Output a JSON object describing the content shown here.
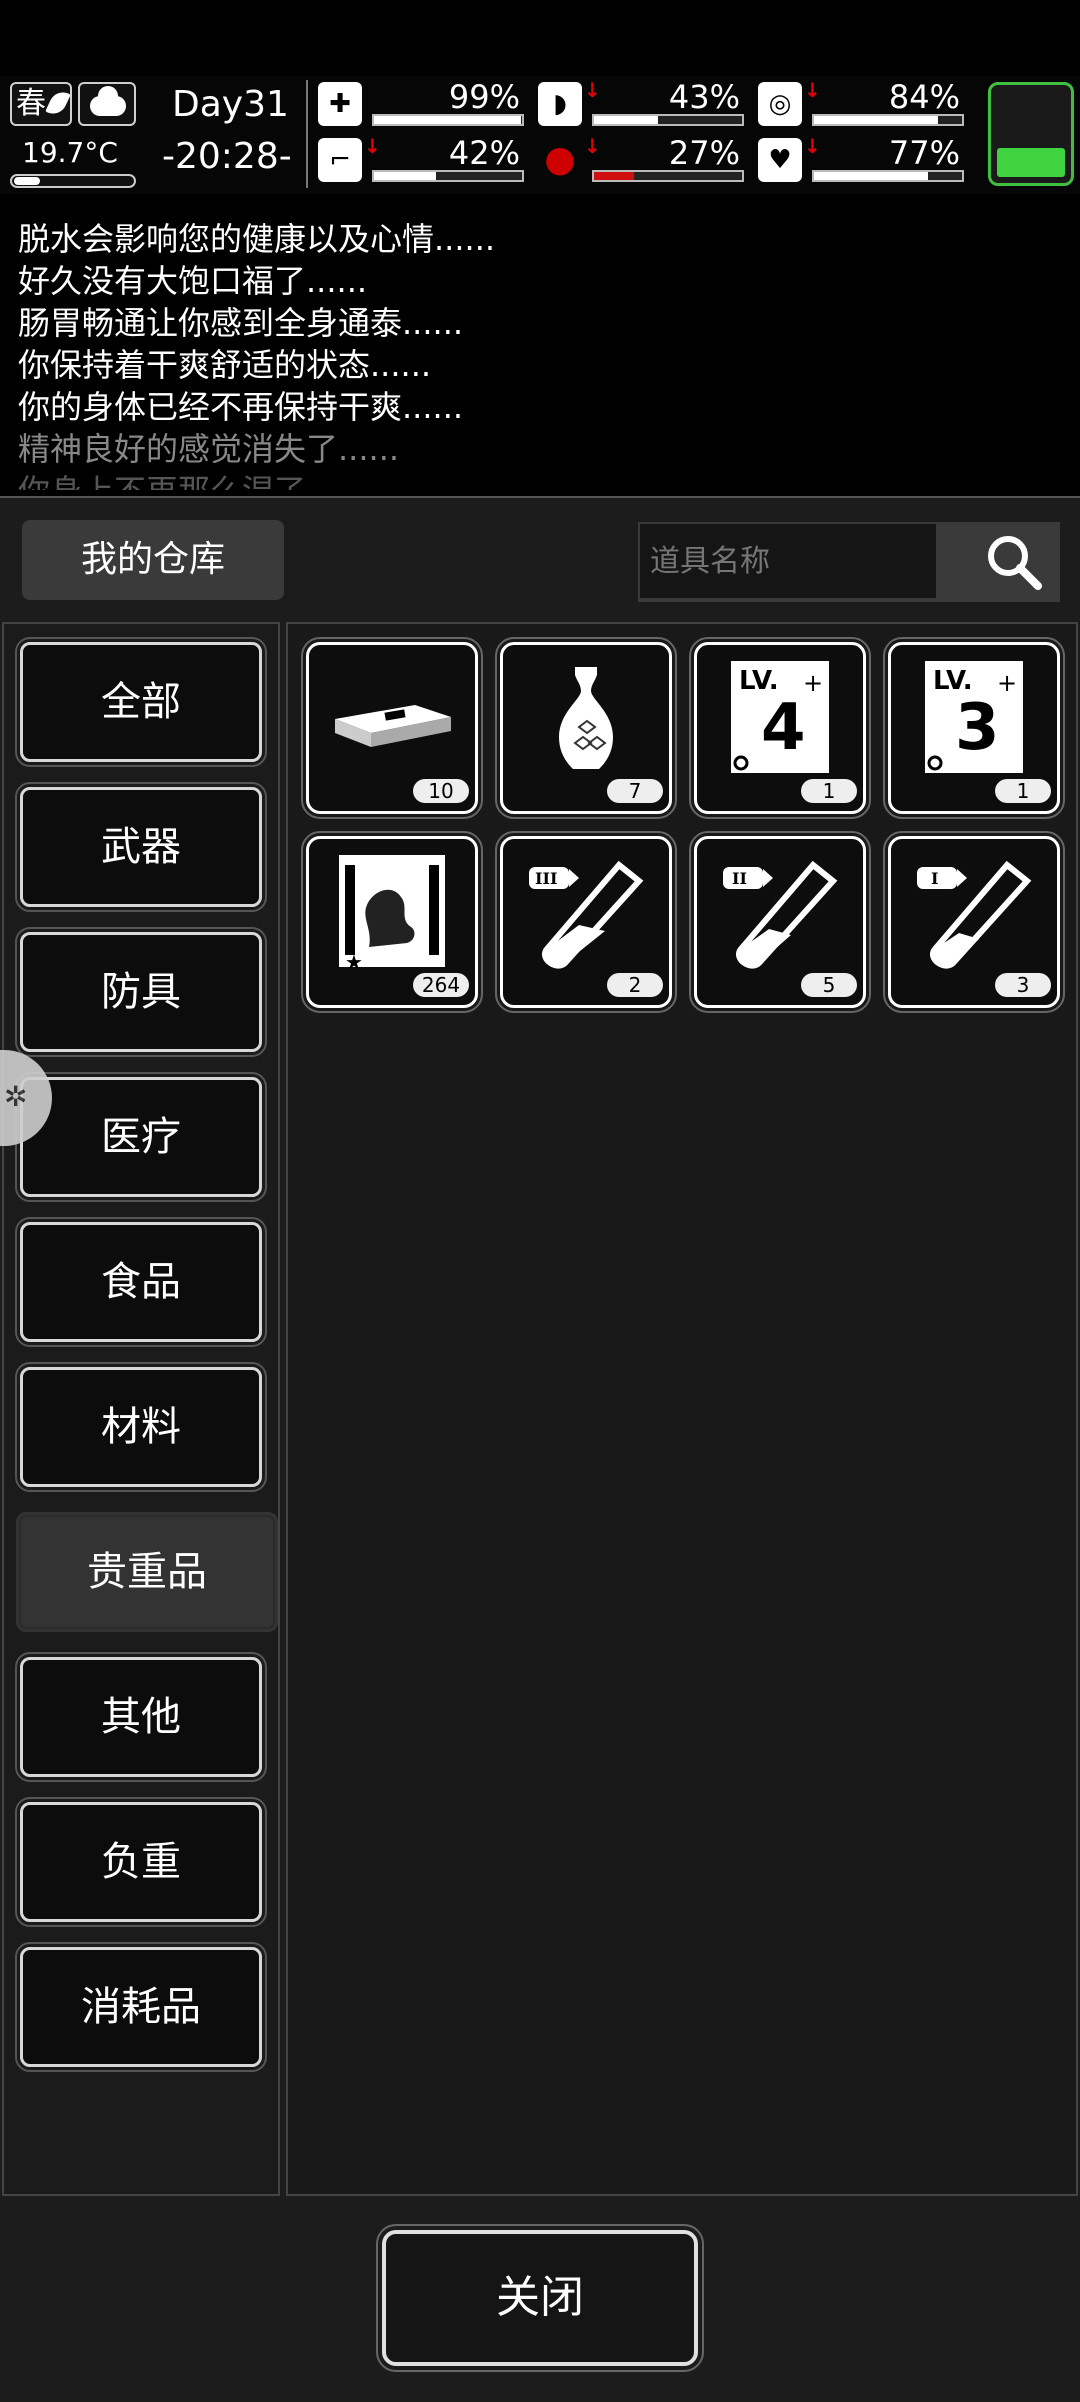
{
  "hud": {
    "season": "春",
    "temperature": "19.7°C",
    "day": "Day31",
    "time": "-20:28-",
    "stats": [
      {
        "name": "health",
        "icon": "medkit-icon",
        "value": "99%",
        "fill": 0.99,
        "trend": "none"
      },
      {
        "name": "hunger",
        "icon": "stomach-icon",
        "value": "43%",
        "fill": 0.43,
        "trend": "down"
      },
      {
        "name": "thirst",
        "icon": "water-can-icon",
        "value": "84%",
        "fill": 0.84,
        "trend": "down"
      },
      {
        "name": "stamina",
        "icon": "boot-icon",
        "value": "42%",
        "fill": 0.42,
        "trend": "down"
      },
      {
        "name": "blood",
        "icon": "blood-drop-icon",
        "value": "27%",
        "fill": 0.27,
        "trend": "down"
      },
      {
        "name": "mood",
        "icon": "heart-icon",
        "value": "77%",
        "fill": 0.77,
        "trend": "down"
      }
    ],
    "battery_fill": 0.3,
    "colors": {
      "battery": "#3fd43f",
      "alert": "#e00000"
    }
  },
  "log": [
    "脱水会影响您的健康以及心情......",
    "好久没有大饱口福了......",
    "肠胃畅通让你感到全身通泰......",
    "你保持着干爽舒适的状态......",
    "你的身体已经不再保持干爽......",
    "精神良好的感觉消失了......",
    "你身上不再那么湿了......"
  ],
  "warehouse": {
    "title": "我的仓库",
    "search_placeholder": "道具名称",
    "categories": [
      "全部",
      "武器",
      "防具",
      "医疗",
      "食品",
      "材料",
      "贵重品",
      "其他",
      "负重",
      "消耗品"
    ],
    "active_category": "贵重品",
    "items": [
      {
        "icon": "cash-bundle-icon",
        "count": "10"
      },
      {
        "icon": "vase-icon",
        "count": "7"
      },
      {
        "icon": "skill-book-lv4-icon",
        "count": "1",
        "label": "LV.",
        "level": "4"
      },
      {
        "icon": "skill-book-lv3-icon",
        "count": "1",
        "label": "LV.",
        "level": "3"
      },
      {
        "icon": "zombie-card-icon",
        "count": "264"
      },
      {
        "icon": "test-tube-iii-icon",
        "count": "2",
        "tier": "III"
      },
      {
        "icon": "test-tube-ii-icon",
        "count": "5",
        "tier": "II"
      },
      {
        "icon": "test-tube-i-icon",
        "count": "3",
        "tier": "I"
      }
    ]
  },
  "close_label": "关闭"
}
